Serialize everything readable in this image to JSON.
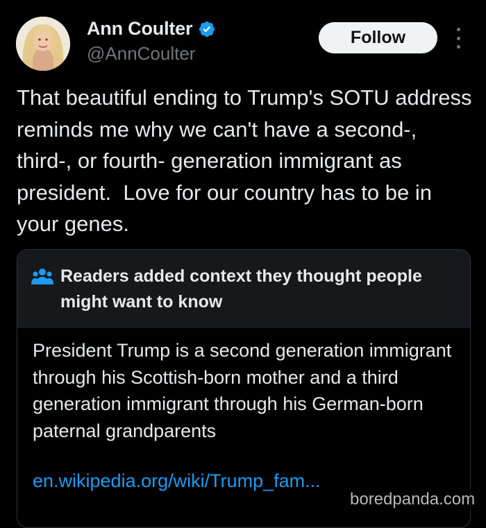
{
  "author": {
    "display_name": "Ann Coulter",
    "handle": "@AnnCoulter",
    "verified_icon": "verified-badge-icon",
    "avatar_icon": "avatar-photo"
  },
  "actions": {
    "follow_label": "Follow",
    "more_icon": "more-vertical-icon"
  },
  "tweet": {
    "text": "That beautiful ending to Trump's SOTU address reminds me why we can't have a second-, third-, or fourth- generation immigrant as president.  Love for our country has to be in your genes."
  },
  "community_note": {
    "header_icon": "people-icon",
    "title": "Readers added context they thought people might want to know",
    "body": "President Trump is a second generation immigrant through his Scottish-born mother and a third generation immigrant through his German-born paternal grandparents",
    "link": "en.wikipedia.org/wiki/Trump_fam..."
  },
  "watermark": "boredpanda.com",
  "colors": {
    "background": "#000000",
    "text_primary": "#e7e9ea",
    "text_secondary": "#71767b",
    "accent_blue": "#1d9bf0",
    "note_header_bg": "#16181c",
    "border": "#2f3336"
  }
}
